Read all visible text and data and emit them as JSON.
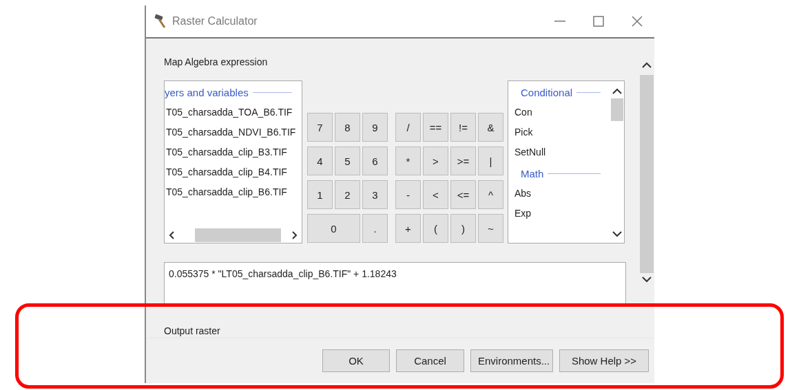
{
  "window": {
    "title": "Raster Calculator"
  },
  "expression_label": "Map Algebra expression",
  "layers_list": {
    "header": "yers and variables",
    "items": [
      "T05_charsadda_TOA_B6.TIF",
      "T05_charsadda_NDVI_B6.TIF",
      "T05_charsadda_clip_B3.TIF",
      "T05_charsadda_clip_B4.TIF",
      "T05_charsadda_clip_B6.TIF"
    ]
  },
  "keypad": {
    "digits": [
      [
        "7",
        "8",
        "9"
      ],
      [
        "4",
        "5",
        "6"
      ],
      [
        "1",
        "2",
        "3"
      ],
      [
        "0",
        "."
      ]
    ],
    "operators": [
      [
        "/",
        "==",
        "!=",
        "&"
      ],
      [
        "*",
        ">",
        ">=",
        "|"
      ],
      [
        "-",
        "<",
        "<=",
        "^"
      ],
      [
        "+",
        "(",
        ")",
        "~"
      ]
    ]
  },
  "functions_list": {
    "groups": [
      {
        "header": "Conditional",
        "items": [
          "Con",
          "Pick",
          "SetNull"
        ]
      },
      {
        "header": "Math",
        "items": [
          "Abs",
          "Exp"
        ]
      }
    ]
  },
  "expression": "0.055375 * \"LT05_charsadda_clip_B6.TIF\" + 1.18243",
  "output_label": "Output raster",
  "buttons": [
    "OK",
    "Cancel",
    "Environments...",
    "Show Help >>"
  ]
}
